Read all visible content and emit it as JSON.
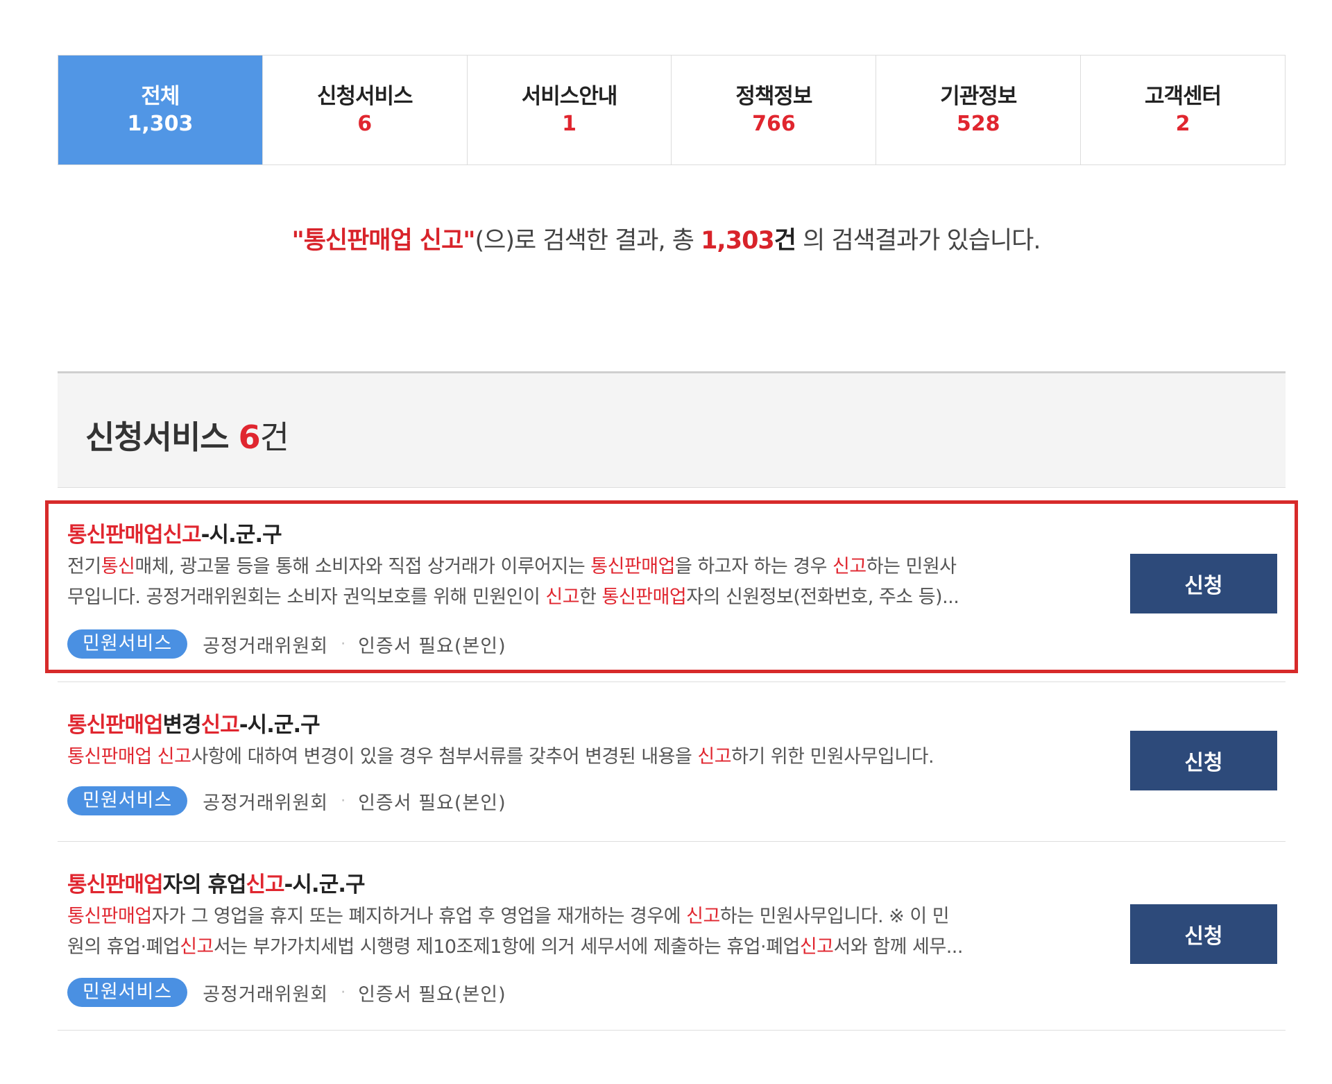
{
  "tabs": [
    {
      "label": "전체",
      "count": "1,303"
    },
    {
      "label": "신청서비스",
      "count": "6"
    },
    {
      "label": "서비스안내",
      "count": "1"
    },
    {
      "label": "정책정보",
      "count": "766"
    },
    {
      "label": "기관정보",
      "count": "528"
    },
    {
      "label": "고객센터",
      "count": "2"
    }
  ],
  "summary": {
    "keyword": "\"통신판매업 신고\"",
    "text_before_count": "(으)로 검색한 결과, 총 ",
    "count": "1,303",
    "unit": "건",
    "text_after": " 의 검색결과가 있습니다."
  },
  "section": {
    "title": "신청서비스",
    "count": "6",
    "unit": "건"
  },
  "results": [
    {
      "title": [
        {
          "t": "통신판매업신고",
          "hl": true
        },
        {
          "t": "-시.군.구",
          "hl": false
        }
      ],
      "desc_line1": [
        {
          "t": "전기",
          "hl": false
        },
        {
          "t": "통신",
          "hl": true
        },
        {
          "t": "매체, 광고물 등을 통해 소비자와 직접 상거래가 이루어지는 ",
          "hl": false
        },
        {
          "t": "통신판매업",
          "hl": true
        },
        {
          "t": "을 하고자 하는 경우 ",
          "hl": false
        },
        {
          "t": "신고",
          "hl": true
        },
        {
          "t": "하는 민원사",
          "hl": false
        }
      ],
      "desc_line2": [
        {
          "t": "무입니다. 공정거래위원회는 소비자 권익보호를 위해 민원인이 ",
          "hl": false
        },
        {
          "t": "신고",
          "hl": true
        },
        {
          "t": "한 ",
          "hl": false
        },
        {
          "t": "통신판매업",
          "hl": true
        },
        {
          "t": "자의 신원정보(전화번호, 주소 등)...",
          "hl": false
        }
      ],
      "badge": "민원서비스",
      "org": "공정거래위원회",
      "separator": "·",
      "cert": "인증서 필요(본인)",
      "button": "신청"
    },
    {
      "title": [
        {
          "t": "통신판매업",
          "hl": true
        },
        {
          "t": "변경",
          "hl": false
        },
        {
          "t": "신고",
          "hl": true
        },
        {
          "t": "-시.군.구",
          "hl": false
        }
      ],
      "desc_line1": [
        {
          "t": "통신판매업 신고",
          "hl": true
        },
        {
          "t": "사항에 대하여 변경이 있을 경우 첨부서류를 갖추어 변경된 내용을 ",
          "hl": false
        },
        {
          "t": "신고",
          "hl": true
        },
        {
          "t": "하기 위한 민원사무입니다.",
          "hl": false
        }
      ],
      "desc_line2": [],
      "badge": "민원서비스",
      "org": "공정거래위원회",
      "separator": "·",
      "cert": "인증서 필요(본인)",
      "button": "신청"
    },
    {
      "title": [
        {
          "t": "통신판매업",
          "hl": true
        },
        {
          "t": "자의 휴업",
          "hl": false
        },
        {
          "t": "신고",
          "hl": true
        },
        {
          "t": "-시.군.구",
          "hl": false
        }
      ],
      "desc_line1": [
        {
          "t": "통신판매업",
          "hl": true
        },
        {
          "t": "자가 그 영업을 휴지 또는 폐지하거나 휴업 후 영업을 재개하는 경우에 ",
          "hl": false
        },
        {
          "t": "신고",
          "hl": true
        },
        {
          "t": "하는 민원사무입니다. ※ 이 민",
          "hl": false
        }
      ],
      "desc_line2": [
        {
          "t": "원의 휴업·폐업",
          "hl": false
        },
        {
          "t": "신고",
          "hl": true
        },
        {
          "t": "서는 부가가치세법 시행령 제10조제1항에 의거 세무서에 제출하는 휴업·폐업",
          "hl": false
        },
        {
          "t": "신고",
          "hl": true
        },
        {
          "t": "서와 함께 세무...",
          "hl": false
        }
      ],
      "badge": "민원서비스",
      "org": "공정거래위원회",
      "separator": "·",
      "cert": "인증서 필요(본인)",
      "button": "신청"
    }
  ]
}
